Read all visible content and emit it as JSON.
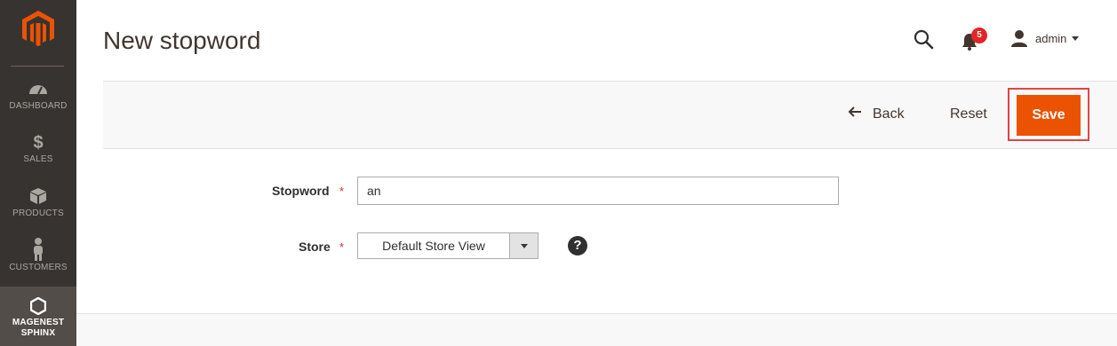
{
  "sidebar": {
    "logo_icon": "magento-logo-icon",
    "items": [
      {
        "label": "DASHBOARD",
        "icon": "dashboard-icon"
      },
      {
        "label": "SALES",
        "icon": "dollar-icon"
      },
      {
        "label": "PRODUCTS",
        "icon": "box-icon"
      },
      {
        "label": "CUSTOMERS",
        "icon": "person-icon"
      },
      {
        "label_line1": "MAGENEST",
        "label_line2": "SPHINX",
        "icon": "hexagon-icon"
      }
    ]
  },
  "header": {
    "title": "New stopword",
    "notifications_count": "5",
    "user_name": "admin"
  },
  "actions": {
    "back_label": "Back",
    "reset_label": "Reset",
    "save_label": "Save"
  },
  "form": {
    "stopword_label": "Stopword",
    "stopword_value": "an",
    "store_label": "Store",
    "store_value": "Default Store View",
    "required_mark": "*",
    "help_mark": "?"
  },
  "colors": {
    "sidebar_bg": "#373330",
    "accent_orange": "#eb5202",
    "highlight_red": "#e04545"
  }
}
